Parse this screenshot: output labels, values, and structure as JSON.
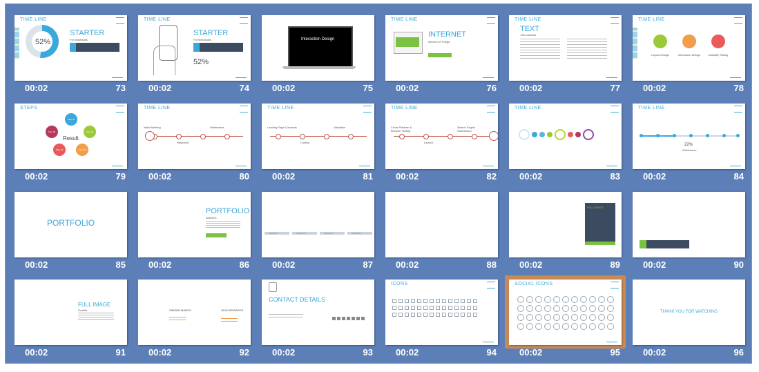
{
  "slides": [
    {
      "num": "73",
      "time": "00:02",
      "header": "TIME LINE",
      "title": "STARTER",
      "subtitle": "For individuals",
      "percent": "52%",
      "slide_no": "73"
    },
    {
      "num": "74",
      "time": "00:02",
      "header": "TIME LINE",
      "title": "STARTER",
      "subtitle": "For individuals",
      "percent": "52%",
      "slide_no": "74"
    },
    {
      "num": "75",
      "time": "00:02",
      "title": "Interaction Design"
    },
    {
      "num": "76",
      "time": "00:02",
      "header": "TIME LINE",
      "title": "INTERNET",
      "subtitle": "Internet of Things",
      "slide_no": "76"
    },
    {
      "num": "77",
      "time": "00:02",
      "header": "TIME LINE",
      "title": "TEXT",
      "subtitle": "Two columns",
      "slide_no": "77"
    },
    {
      "num": "78",
      "time": "00:02",
      "header": "TIME LINE",
      "slide_no": "78",
      "labels": [
        "Layout Design",
        "Interaction Design",
        "Usability Testing"
      ]
    },
    {
      "num": "79",
      "time": "00:02",
      "header": "STEPS",
      "slide_no": "79",
      "result": "Result",
      "steps": [
        "Step 01",
        "Step 02",
        "Step 03",
        "Step 04",
        "Step 05"
      ]
    },
    {
      "num": "80",
      "time": "00:02",
      "header": "TIME LINE",
      "slide_no": "80",
      "labels": [
        "Initial Meeting",
        "Research",
        "Wireframes"
      ]
    },
    {
      "num": "81",
      "time": "00:02",
      "header": "TIME LINE",
      "slide_no": "81",
      "labels": [
        "Landing Page Concepts",
        "Coding",
        "Validation"
      ]
    },
    {
      "num": "82",
      "time": "00:02",
      "header": "TIME LINE",
      "slide_no": "82",
      "labels": [
        "Cross Platform & Browser Testing",
        "Launch",
        "Search Engine Submission"
      ]
    },
    {
      "num": "83",
      "time": "00:02",
      "header": "TIME LINE",
      "slide_no": "83"
    },
    {
      "num": "84",
      "time": "00:02",
      "header": "TIME LINE",
      "slide_no": "84",
      "percent": "22%",
      "sublabel": "Wireframes"
    },
    {
      "num": "85",
      "time": "00:02",
      "title": "PORTFOLIO",
      "slide_no": "85"
    },
    {
      "num": "86",
      "time": "00:02",
      "title": "PORTFOLIO",
      "subtitle": "IMAGES",
      "slide_no": "86"
    },
    {
      "num": "87",
      "time": "00:02",
      "slide_no": "87",
      "labels": [
        "IMAGE 01",
        "IMAGE 02",
        "IMAGE 03",
        "IMAGE 04"
      ]
    },
    {
      "num": "88",
      "time": "00:02"
    },
    {
      "num": "89",
      "time": "00:02",
      "title": "FULL IMAGE"
    },
    {
      "num": "90",
      "time": "00:02"
    },
    {
      "num": "91",
      "time": "00:02",
      "title": "FULL IMAGE",
      "subtitle": "Subtitle"
    },
    {
      "num": "92",
      "time": "00:02",
      "slide_no": "92",
      "name_a": "SIMONE MARCO",
      "name_b": "GLEN EDWARDS"
    },
    {
      "num": "93",
      "time": "00:02",
      "title": "CONTACT DETAILS",
      "slide_no": "93"
    },
    {
      "num": "94",
      "time": "00:02",
      "header": "ICONS",
      "slide_no": "94"
    },
    {
      "num": "95",
      "time": "00:02",
      "header": "SOCIAL ICONS",
      "slide_no": "95"
    },
    {
      "num": "96",
      "time": "00:02",
      "title": "THANK YOU FOR WATCHING"
    }
  ],
  "colors": {
    "background": "#5d7fb8",
    "accent": "#3aa8d8",
    "green": "#7cc242",
    "navy": "#3d4b61",
    "selection": "#c88a55"
  }
}
